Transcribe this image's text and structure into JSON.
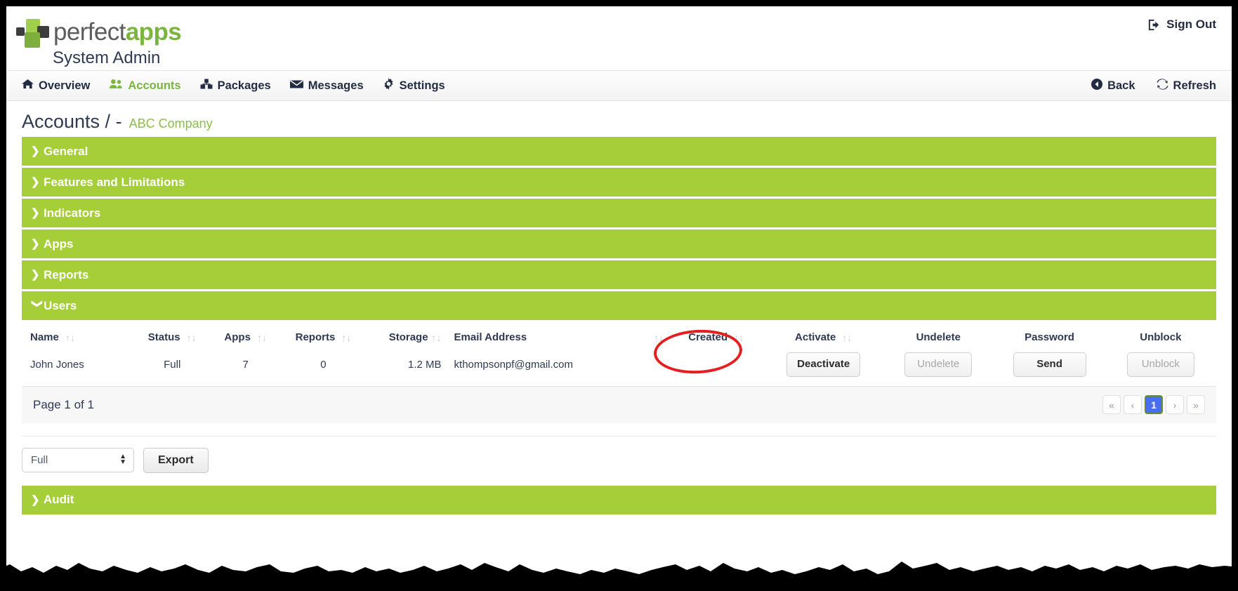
{
  "header": {
    "logo": {
      "first": "perfect",
      "second": "apps",
      "mark": "perfectapps-logo-icon"
    },
    "subtitle": "System Admin",
    "signout_label": "Sign Out"
  },
  "nav": {
    "items": [
      {
        "label": "Overview",
        "icon": "home-icon",
        "active": false
      },
      {
        "label": "Accounts",
        "icon": "users-icon",
        "active": true
      },
      {
        "label": "Packages",
        "icon": "packages-icon",
        "active": false
      },
      {
        "label": "Messages",
        "icon": "envelope-icon",
        "active": false
      },
      {
        "label": "Settings",
        "icon": "gear-icon",
        "active": false
      }
    ],
    "back_label": "Back",
    "refresh_label": "Refresh"
  },
  "breadcrumb": {
    "main": "Accounts / -",
    "account": "ABC Company"
  },
  "sections": [
    {
      "label": "General",
      "expanded": false
    },
    {
      "label": "Features and Limitations",
      "expanded": false
    },
    {
      "label": "Indicators",
      "expanded": false
    },
    {
      "label": "Apps",
      "expanded": false
    },
    {
      "label": "Reports",
      "expanded": false
    },
    {
      "label": "Users",
      "expanded": true
    },
    {
      "label": "Audit",
      "expanded": false
    }
  ],
  "users_table": {
    "columns": [
      {
        "label": "Name",
        "sortable": true
      },
      {
        "label": "Status",
        "sortable": true
      },
      {
        "label": "Apps",
        "sortable": true
      },
      {
        "label": "Reports",
        "sortable": true
      },
      {
        "label": "Storage",
        "sortable": true
      },
      {
        "label": "Email Address",
        "sortable": true
      },
      {
        "label": "Created",
        "sortable": true
      },
      {
        "label": "Activate",
        "sortable": true
      },
      {
        "label": "Undelete",
        "sortable": false
      },
      {
        "label": "Password",
        "sortable": false
      },
      {
        "label": "Unblock",
        "sortable": false
      }
    ],
    "rows": [
      {
        "name": "John Jones",
        "status": "Full",
        "apps": "7",
        "reports": "0",
        "storage": "1.2 MB",
        "email": "kthompsonpf@gmail.com",
        "created": "",
        "activate_label": "Deactivate",
        "activate_enabled": true,
        "undelete_label": "Undelete",
        "undelete_enabled": false,
        "password_label": "Send",
        "password_enabled": true,
        "unblock_label": "Unblock",
        "unblock_enabled": false
      }
    ],
    "sort_icon": "↑↓"
  },
  "pagination": {
    "page_text": "Page 1 of 1",
    "first": "«",
    "prev": "‹",
    "current": "1",
    "next": "›",
    "last": "»"
  },
  "export": {
    "selected": "Full",
    "options": [
      "Full"
    ],
    "button_label": "Export"
  },
  "annotation": {
    "type": "red-ellipse-highlight",
    "targets": "Deactivate button"
  },
  "colors": {
    "accent_green": "#a6ce39",
    "logo_green": "#7ab63f",
    "brand_dark": "#2f3a52",
    "pager_active": "#4a6ef0",
    "annotation_red": "#e41f1f"
  }
}
